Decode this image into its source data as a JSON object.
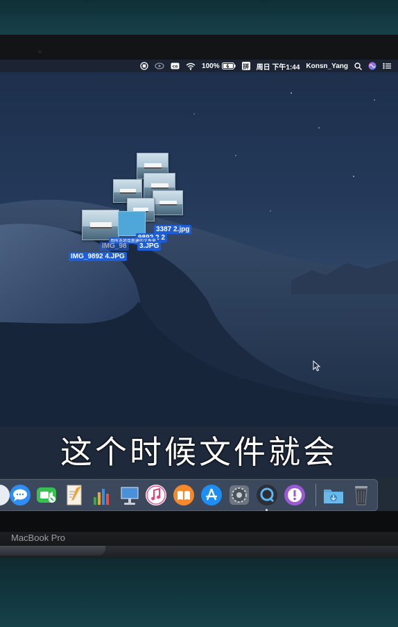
{
  "menubar": {
    "battery": "100%",
    "input_method": "拼",
    "datetime": "周日 下午1:44",
    "user": "Konsn_Yang"
  },
  "desktop": {
    "files": [
      {
        "label": "3387 2.jpg"
      },
      {
        "label": "9892 2 2"
      },
      {
        "label": "IMG_98"
      },
      {
        "label": "3.JPG"
      },
      {
        "label": "IMG_9892 4.JPG"
      },
      {
        "label": "用所选项目新建的文件夹"
      }
    ]
  },
  "caption": "这个时候文件就会",
  "dock": {
    "items": [
      "messages",
      "facetime",
      "pages",
      "numbers",
      "keynote",
      "itunes",
      "ibooks",
      "app-store",
      "system-preferences",
      "quicktime",
      "feedback-assistant",
      "downloads",
      "trash"
    ]
  },
  "device": {
    "brand": "MacBook Pro"
  },
  "colors": {
    "selection_blue": "#1d5ed8",
    "menubar": "#1c2433",
    "desktop_night": "#24395a"
  }
}
